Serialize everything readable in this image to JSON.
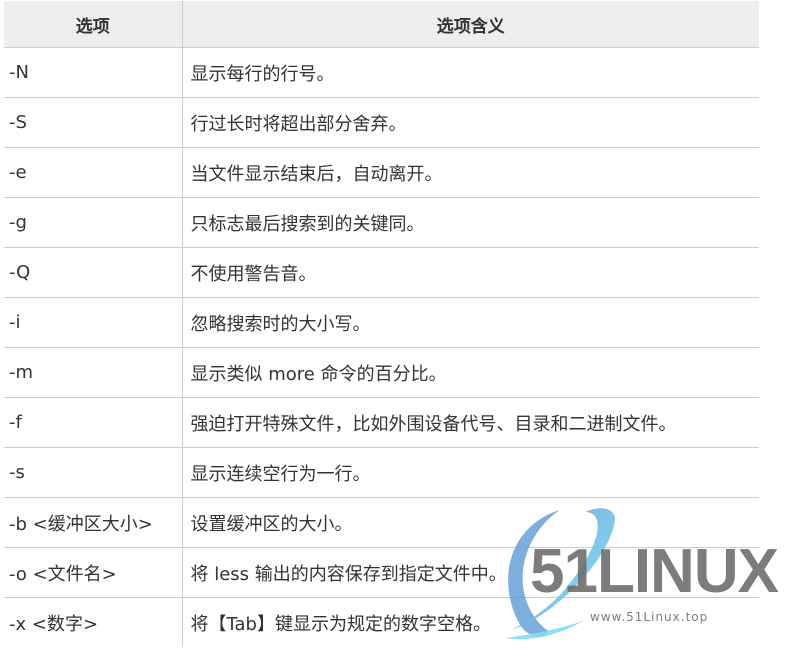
{
  "table": {
    "headers": [
      "选项",
      "选项含义"
    ],
    "rows": [
      {
        "option": "-N",
        "meaning": "显示每行的行号。"
      },
      {
        "option": "-S",
        "meaning": "行过长时将超出部分舍弃。"
      },
      {
        "option": "-e",
        "meaning": "当文件显示结束后，自动离开。"
      },
      {
        "option": "-g",
        "meaning": "只标志最后搜索到的关键同。"
      },
      {
        "option": "-Q",
        "meaning": "不使用警告音。"
      },
      {
        "option": "-i",
        "meaning": "忽略搜索时的大小写。"
      },
      {
        "option": "-m",
        "meaning": "显示类似 more 命令的百分比。"
      },
      {
        "option": "-f",
        "meaning": "强迫打开特殊文件，比如外围设备代号、目录和二进制文件。"
      },
      {
        "option": "-s",
        "meaning": "显示连续空行为一行。"
      },
      {
        "option": "-b <缓冲区大小>",
        "meaning": "设置缓冲区的大小。"
      },
      {
        "option": "-o <文件名>",
        "meaning": "将 less 输出的内容保存到指定文件中。"
      },
      {
        "option": "-x <数字>",
        "meaning": "将【Tab】键显示为规定的数字空格。"
      }
    ]
  },
  "watermark": {
    "brand": "51LINUX",
    "url": "www.51Linux.top",
    "icon": "orbit-ring-logo-icon",
    "colors": {
      "ring_dark": "#5b9bd5",
      "ring_light": "#7fdcf7",
      "text": "#6e6e6e"
    }
  },
  "colors": {
    "header_bg": "#eeeeee",
    "border": "#cccccc",
    "text": "#333333"
  }
}
